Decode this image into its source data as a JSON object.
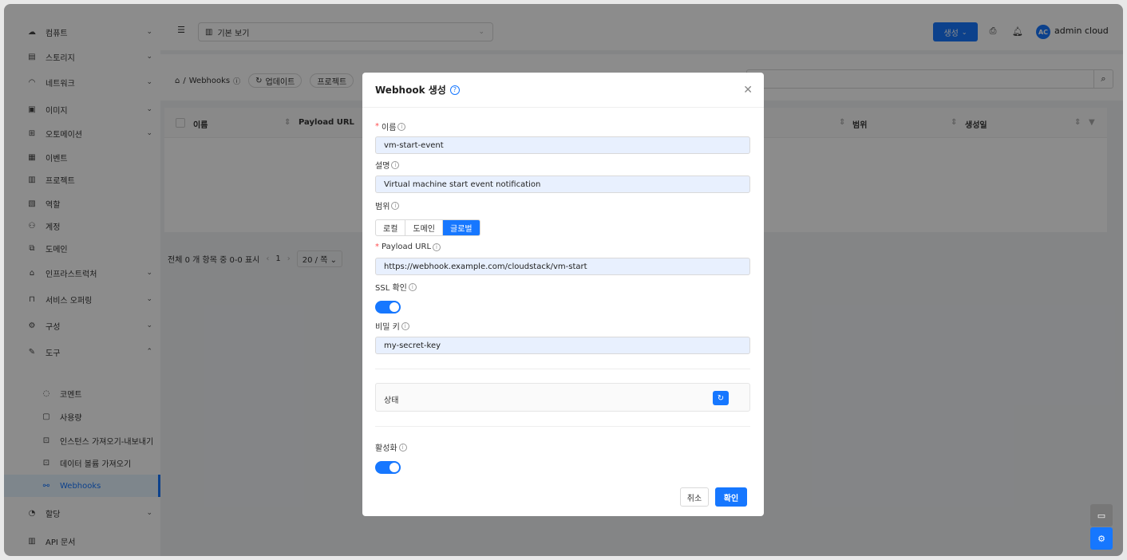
{
  "sidebar": {
    "items": [
      {
        "label": "컴퓨트",
        "icon": "cloud-icon",
        "expand": true
      },
      {
        "label": "스토리지",
        "icon": "storage-icon",
        "expand": true
      },
      {
        "label": "네트워크",
        "icon": "wifi-icon",
        "expand": true
      },
      {
        "label": "이미지",
        "icon": "image-icon",
        "expand": true
      },
      {
        "label": "오토메이션",
        "icon": "automation-icon",
        "expand": true
      },
      {
        "label": "이벤트",
        "icon": "calendar-icon",
        "expand": false
      },
      {
        "label": "프로젝트",
        "icon": "project-icon",
        "expand": false
      },
      {
        "label": "역할",
        "icon": "role-icon",
        "expand": false
      },
      {
        "label": "계정",
        "icon": "users-icon",
        "expand": false
      },
      {
        "label": "도메인",
        "icon": "domain-icon",
        "expand": false
      },
      {
        "label": "인프라스트럭처",
        "icon": "bank-icon",
        "expand": true
      },
      {
        "label": "서비스 오퍼링",
        "icon": "shopping-icon",
        "expand": true
      },
      {
        "label": "구성",
        "icon": "gear-icon",
        "expand": true
      },
      {
        "label": "도구",
        "icon": "tool-icon",
        "expand": true
      }
    ],
    "subitems": [
      {
        "label": "코멘트",
        "icon": "comment-icon"
      },
      {
        "label": "사용량",
        "icon": "usage-icon"
      },
      {
        "label": "인스턴스 가져오기-내보내기",
        "icon": "import-icon"
      },
      {
        "label": "데이터 볼륨 가져오기",
        "icon": "volume-icon"
      },
      {
        "label": "Webhooks",
        "icon": "webhook-icon"
      }
    ],
    "tail": [
      {
        "label": "할당",
        "icon": "pie-icon",
        "expand": true
      },
      {
        "label": "API 문서",
        "icon": "book-icon",
        "expand": false
      }
    ]
  },
  "topbar": {
    "view_select": "기본 보기",
    "create_label": "생성",
    "user_name": "admin cloud",
    "avatar_initials": "AC"
  },
  "page": {
    "breadcrumb": "Webhooks",
    "refresh_label": "업데이트",
    "project_toggle_label": "프로젝트"
  },
  "table": {
    "columns": [
      "이름",
      "Payload URL",
      "범위",
      "생성일"
    ]
  },
  "pager": {
    "summary": "전체 0 개 항목 중 0-0 표시",
    "current_page": "1",
    "page_size": "20 / 쪽"
  },
  "modal": {
    "title": "Webhook 생성",
    "fields": {
      "name_label": "이름",
      "name_value": "vm-start-event",
      "desc_label": "설명",
      "desc_value": "Virtual machine start event notification",
      "scope_label": "범위",
      "scope_options": [
        "로컬",
        "도메인",
        "글로벌"
      ],
      "scope_selected": "글로벌",
      "url_label": "Payload URL",
      "url_value": "https://webhook.example.com/cloudstack/vm-start",
      "ssl_label": "SSL 확인",
      "ssl_on": true,
      "secret_label": "비밀 키",
      "secret_value": "my-secret-key",
      "status_label": "상태",
      "active_label": "활성화",
      "active_on": true
    },
    "cancel_label": "취소",
    "ok_label": "확인"
  },
  "colors": {
    "accent": "#1677ff",
    "active_bg": "#e6f4ff",
    "required": "#ff4d4f"
  }
}
